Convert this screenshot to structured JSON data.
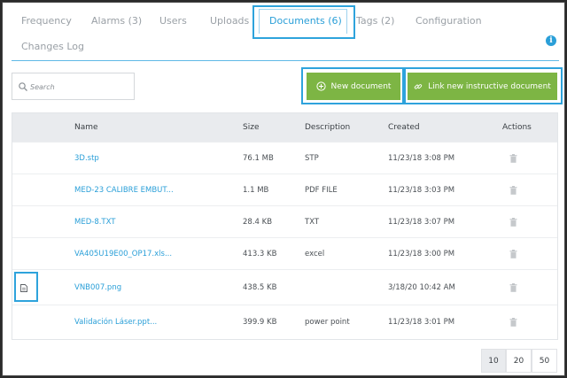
{
  "tabs": [
    {
      "label": "Frequency"
    },
    {
      "label": "Alarms (3)"
    },
    {
      "label": "Users"
    },
    {
      "label": "Uploads"
    },
    {
      "label": "Documents (6)"
    },
    {
      "label": "Tags (2)"
    },
    {
      "label": "Configuration"
    },
    {
      "label": "Changes Log"
    }
  ],
  "search": {
    "placeholder": "Search"
  },
  "actions": {
    "new_document": "New document",
    "link_instructive": "Link new instructive document"
  },
  "table": {
    "headers": {
      "name": "Name",
      "size": "Size",
      "description": "Description",
      "created": "Created",
      "actions": "Actions"
    },
    "rows": [
      {
        "name": "3D.stp",
        "size": "76.1 MB",
        "description": "STP",
        "created": "11/23/18 3:08 PM"
      },
      {
        "name": "MED-23 CALIBRE EMBUT...",
        "size": "1.1 MB",
        "description": "PDF FILE",
        "created": "11/23/18 3:03 PM"
      },
      {
        "name": "MED-8.TXT",
        "size": "28.4 KB",
        "description": "TXT",
        "created": "11/23/18 3:07 PM"
      },
      {
        "name": "VA405U19E00_OP17.xls...",
        "size": "413.3 KB",
        "description": "excel",
        "created": "11/23/18 3:00 PM"
      },
      {
        "name": "VNB007.png",
        "size": "438.5 KB",
        "description": "",
        "created": "3/18/20 10:42 AM"
      },
      {
        "name": "Validación Láser.ppt...",
        "size": "399.9 KB",
        "description": "power point",
        "created": "11/23/18 3:01 PM"
      }
    ]
  },
  "pagination": {
    "sizes": [
      "10",
      "20",
      "50"
    ],
    "active": "10"
  },
  "icons": {
    "info": "info-icon",
    "search": "search-icon",
    "plus": "plus-circle-icon",
    "link": "link-icon",
    "trash": "trash-icon",
    "document": "document-icon"
  },
  "colors": {
    "accent": "#2a9fd8",
    "button": "#7db544",
    "highlight": "#2ea3dc"
  }
}
